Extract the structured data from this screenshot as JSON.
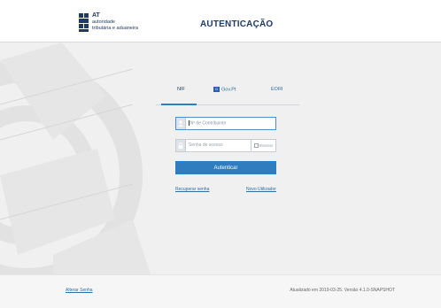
{
  "header": {
    "logo_line1": "AT",
    "logo_line2": "autoridade",
    "logo_line3": "tributária e aduaneira",
    "title": "AUTENTICAÇÃO"
  },
  "login": {
    "tabs": [
      {
        "label": "NIF",
        "active": true
      },
      {
        "label": "Gov.Pt",
        "badge": "G"
      },
      {
        "label": "EORI"
      }
    ],
    "nif_placeholder": "Nº de Contribuinte",
    "password_placeholder": "Senha de acesso",
    "show_password_label": "Mostrar",
    "submit_label": "Autenticar",
    "recover_label": "Recuperar senha",
    "new_user_label": "Novo Utilizador"
  },
  "footer": {
    "alert_label": "Alterar Senha",
    "version_text": "Atualizado em 2019-03-25. Versão 4.1.0-SNAPSHOT"
  },
  "colors": {
    "accent": "#2f7dbf",
    "brand_dark": "#1e3a66",
    "background": "#f0f0f0"
  }
}
